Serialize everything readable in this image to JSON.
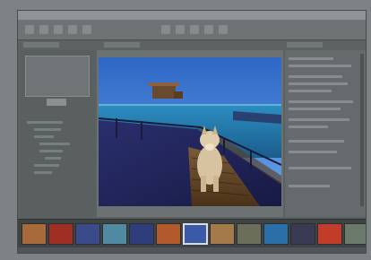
{
  "app": {
    "title": "",
    "accent": "#7d8384"
  },
  "toolbar": {
    "buttons": [
      "rotate-icon",
      "crop-icon",
      "zoom-icon",
      "compare-icon",
      "info-icon",
      "star-icon",
      "flag-icon",
      "label-icon",
      "view-icon",
      "share-icon"
    ]
  },
  "tabs": [
    "",
    "",
    ""
  ],
  "left_panel": {
    "items": [
      "",
      "",
      "",
      "",
      "",
      "",
      "",
      "",
      "",
      ""
    ]
  },
  "right_panel": {
    "metadata_rows": [
      "",
      "",
      "",
      "",
      "",
      "",
      "",
      "",
      "",
      "",
      "",
      "",
      ""
    ]
  },
  "filmstrip": {
    "selected_index": 6,
    "thumbs": [
      {
        "color": "#a86a3a"
      },
      {
        "color": "#a02e25"
      },
      {
        "color": "#3b4b8a"
      },
      {
        "color": "#4f8aa0"
      },
      {
        "color": "#2f3e7a"
      },
      {
        "color": "#b35a2c"
      },
      {
        "color": "#3a5aa8"
      },
      {
        "color": "#a57a4a"
      },
      {
        "color": "#6b6f5a"
      },
      {
        "color": "#2b6fa8"
      },
      {
        "color": "#3a3a55"
      },
      {
        "color": "#c23c2a"
      },
      {
        "color": "#6a7a6a"
      }
    ]
  }
}
